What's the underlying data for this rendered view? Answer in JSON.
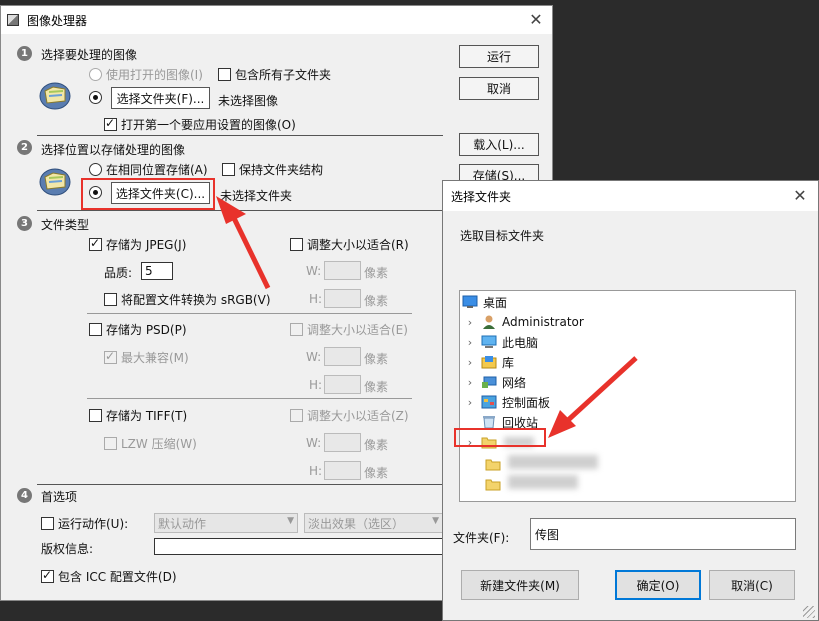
{
  "ip": {
    "title": "图像处理器",
    "s1": {
      "num": "1",
      "heading": "选择要处理的图像",
      "use_open": "使用打开的图像(I)",
      "include_sub": "包含所有子文件夹",
      "choose_folder": "选择文件夹(F)...",
      "no_image": "未选择图像",
      "open_first": "打开第一个要应用设置的图像(O)"
    },
    "s2": {
      "num": "2",
      "heading": "选择位置以存储处理的图像",
      "same_loc": "在相同位置存储(A)",
      "keep_struct": "保持文件夹结构",
      "choose_folder": "选择文件夹(C)...",
      "no_folder": "未选择文件夹"
    },
    "s3": {
      "num": "3",
      "heading": "文件类型",
      "jpeg": "存储为 JPEG(J)",
      "resize_r": "调整大小以适合(R)",
      "quality_label": "品质:",
      "quality_value": "5",
      "w": "W:",
      "h": "H:",
      "px": "像素",
      "srgb": "将配置文件转换为 sRGB(V)",
      "psd": "存储为 PSD(P)",
      "resize_e": "调整大小以适合(E)",
      "max_compat": "最大兼容(M)",
      "tiff": "存储为 TIFF(T)",
      "resize_z": "调整大小以适合(Z)",
      "lzw": "LZW 压缩(W)"
    },
    "s4": {
      "num": "4",
      "heading": "首选项",
      "run_action": "运行动作(U):",
      "action_set": "默认动作",
      "action": "淡出效果（选区）",
      "copyright": "版权信息:",
      "icc": "包含 ICC 配置文件(D)"
    },
    "buttons": {
      "run": "运行",
      "cancel": "取消",
      "load": "载入(L)...",
      "save": "存储(S)..."
    }
  },
  "fd": {
    "title": "选择文件夹",
    "prompt": "选取目标文件夹",
    "tree": [
      "桌面",
      "Administrator",
      "此电脑",
      "库",
      "网络",
      "控制面板",
      "回收站"
    ],
    "folder_label": "文件夹(F):",
    "folder_value": "传图",
    "new_folder": "新建文件夹(M)",
    "ok": "确定(O)",
    "cancel": "取消(C)"
  },
  "colors": {
    "annotation_red": "#e8322b",
    "focus_blue": "#0078d7"
  },
  "icons": {
    "desktop": "desktop-icon",
    "user": "user-icon",
    "pc": "computer-icon",
    "lib": "library-icon",
    "net": "network-icon",
    "cp": "control-panel-icon",
    "bin": "recycle-bin-icon"
  }
}
